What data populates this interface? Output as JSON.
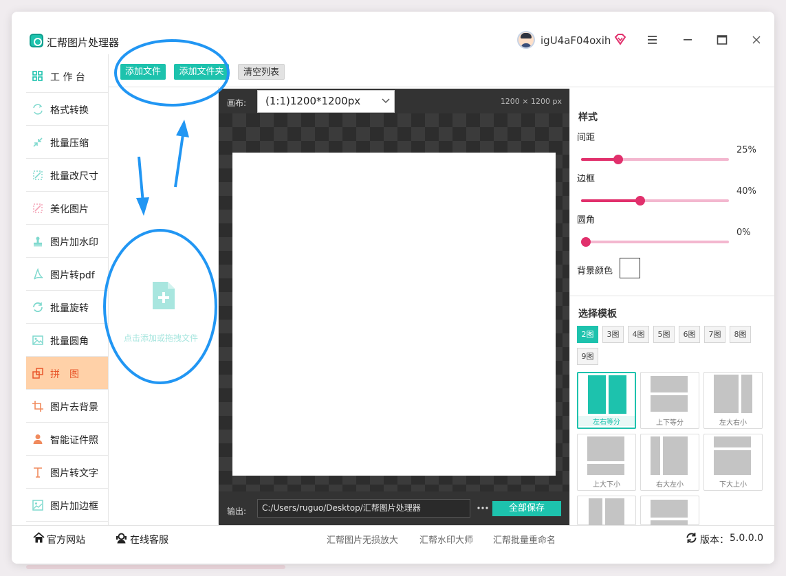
{
  "app": {
    "title": "汇帮图片处理器",
    "username": "igU4aF04oxih",
    "icons": [
      "menu-icon",
      "minimize-icon",
      "maximize-icon",
      "close-icon"
    ]
  },
  "sidebar": {
    "items": [
      {
        "label": "工 作 台",
        "icon": "grid-icon",
        "active": false
      },
      {
        "label": "格式转换",
        "icon": "convert-icon",
        "active": false
      },
      {
        "label": "批量压缩",
        "icon": "compress-icon",
        "active": false
      },
      {
        "label": "批量改尺寸",
        "icon": "resize-icon",
        "active": false
      },
      {
        "label": "美化图片",
        "icon": "beautify-icon",
        "active": false
      },
      {
        "label": "图片加水印",
        "icon": "stamp-icon",
        "active": false
      },
      {
        "label": "图片转pdf",
        "icon": "pdf-icon",
        "active": false
      },
      {
        "label": "批量旋转",
        "icon": "rotate-icon",
        "active": false
      },
      {
        "label": "批量圆角",
        "icon": "image-icon",
        "active": false
      },
      {
        "label": "拼　图",
        "icon": "puzzle-icon",
        "active": true
      },
      {
        "label": "图片去背景",
        "icon": "crop-icon",
        "active": false
      },
      {
        "label": "智能证件照",
        "icon": "person-icon",
        "active": false
      },
      {
        "label": "图片转文字",
        "icon": "text-icon",
        "active": false
      },
      {
        "label": "图片加边框",
        "icon": "frame-icon",
        "active": false
      }
    ]
  },
  "toolbar": {
    "add_file": "添加文件",
    "add_folder": "添加文件夹",
    "clear_list": "清空列表"
  },
  "drop_area": {
    "text": "点击添加或拖拽文件"
  },
  "canvas": {
    "label": "画布:",
    "selected": "(1:1)1200*1200px",
    "size_text": "1200 × 1200 px",
    "output_label": "输出:",
    "output_path": "C:/Users/ruguo/Desktop/汇帮图片处理器",
    "save_all": "全部保存"
  },
  "style_panel": {
    "title": "样式",
    "sliders": [
      {
        "label": "间距",
        "value_text": "25%",
        "value": 0.25
      },
      {
        "label": "边框",
        "value_text": "40%",
        "value": 0.4
      },
      {
        "label": "圆角",
        "value_text": "0%",
        "value": 0.0
      }
    ],
    "bg_color_label": "背景颜色",
    "bg_color": "#ffffff"
  },
  "templates": {
    "title": "选择模板",
    "tabs": [
      "2图",
      "3图",
      "4图",
      "5图",
      "6图",
      "7图",
      "8图",
      "9图"
    ],
    "active_tab": "2图",
    "cards": [
      {
        "label": "左右等分",
        "active": true
      },
      {
        "label": "上下等分",
        "active": false
      },
      {
        "label": "左大右小",
        "active": false
      },
      {
        "label": "上大下小",
        "active": false
      },
      {
        "label": "右大左小",
        "active": false
      },
      {
        "label": "下大上小",
        "active": false
      },
      {
        "label": "",
        "active": false
      },
      {
        "label": "",
        "active": false
      }
    ]
  },
  "bottombar": {
    "website": "官方网站",
    "support": "在线客服",
    "links": [
      "汇帮图片无损放大",
      "汇帮水印大师",
      "汇帮批量重命名"
    ],
    "version_label": "版本：",
    "version": "5.0.0.0"
  },
  "colors": {
    "accent": "#1dc2ad",
    "active_nav_bg": "#ffd1a8",
    "active_nav_text": "#e8562a",
    "slider": "#e1306c",
    "annotation": "#2196f3"
  }
}
